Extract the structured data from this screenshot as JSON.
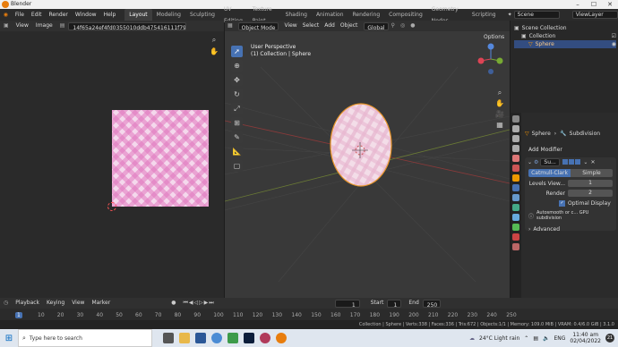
{
  "window": {
    "title": "Blender"
  },
  "menu": [
    "File",
    "Edit",
    "Render",
    "Window",
    "Help"
  ],
  "workspaces": [
    "Layout",
    "Modeling",
    "Sculpting",
    "UV Editing",
    "Texture Paint",
    "Shading",
    "Animation",
    "Rendering",
    "Compositing",
    "Geometry Nodes",
    "Scripting"
  ],
  "scene": {
    "name": "Scene",
    "view_layer": "ViewLayer"
  },
  "image_editor": {
    "menu": [
      "View",
      "Image"
    ],
    "filename": "14f65a24ef4fd0355010ddb475416111f79b068.jpeg"
  },
  "viewport": {
    "mode": "Object Mode",
    "menu": [
      "View",
      "Select",
      "Add",
      "Object"
    ],
    "orientation": "Global",
    "overlay_title": "User Perspective",
    "overlay_sub": "(1) Collection | Sphere",
    "options_label": "Options"
  },
  "outliner": {
    "root": "Scene Collection",
    "collection": "Collection",
    "object": "Sphere"
  },
  "properties": {
    "breadcrumb_obj": "Sphere",
    "breadcrumb_mod": "Subdivision",
    "add_modifier": "Add Modifier",
    "modifier_name": "Su...",
    "catmull": "Catmull-Clark",
    "simple": "Simple",
    "levels_label": "Levels View...",
    "levels_value": "1",
    "render_label": "Render",
    "render_value": "2",
    "optimal_display": "Optimal Display",
    "autosmooth": "Autosmooth or c... GPU subdivision",
    "advanced": "Advanced"
  },
  "timeline": {
    "menu": [
      "Playback",
      "Keying",
      "View",
      "Marker"
    ],
    "current_frame": "1",
    "start_label": "Start",
    "start_value": "1",
    "end_label": "End",
    "end_value": "250",
    "ruler": [
      "1",
      "10",
      "20",
      "30",
      "40",
      "50",
      "60",
      "70",
      "80",
      "90",
      "100",
      "110",
      "120",
      "130",
      "140",
      "150",
      "160",
      "170",
      "180",
      "190",
      "200",
      "210",
      "220",
      "230",
      "240",
      "250"
    ]
  },
  "status": "Collection | Sphere | Verts:338 | Faces:336 | Tris:672 | Objects:1/1 | Memory: 109.0 MiB | VRAM: 0.4/6.0 GiB | 3.1.0",
  "taskbar": {
    "search_placeholder": "Type here to search",
    "weather": "24°C  Light rain",
    "lang": "ENG",
    "time": "11:40 am",
    "date": "02/04/2022",
    "notif": "21"
  }
}
